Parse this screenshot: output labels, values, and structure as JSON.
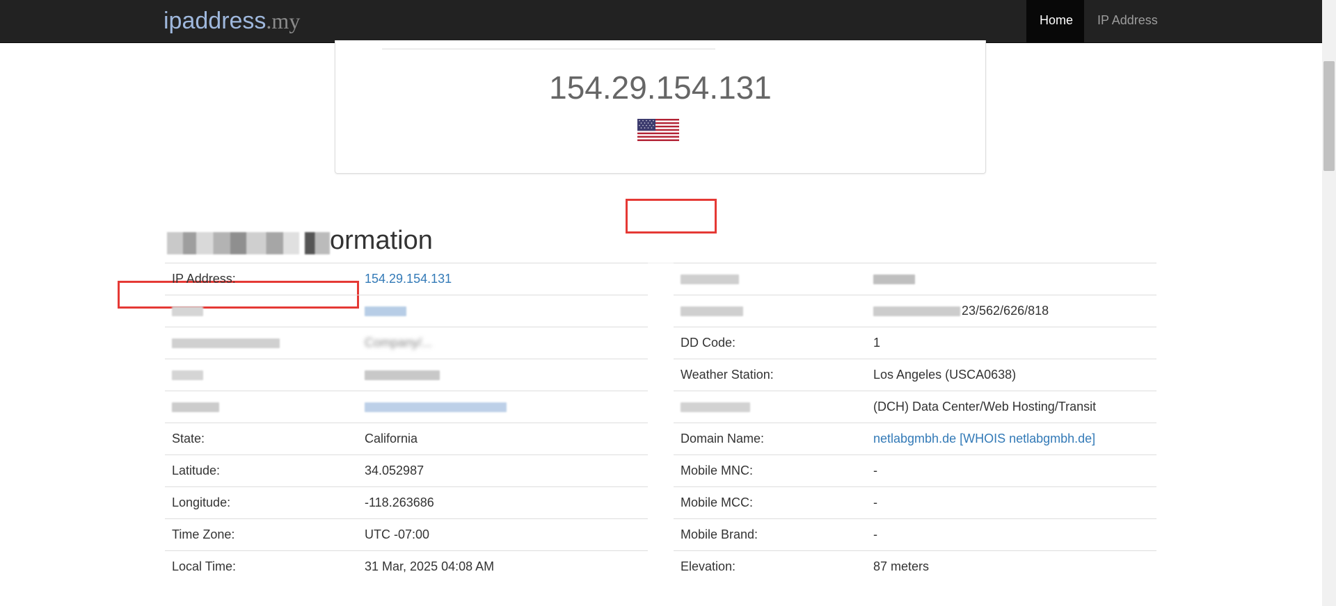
{
  "navbar": {
    "brand_main": "ipaddress",
    "brand_tld": ".my",
    "nav_home": "Home",
    "nav_ip_address": "IP Address"
  },
  "ip_panel": {
    "ip_value": "154.29.154.131",
    "flag_icon": "us-flag-icon"
  },
  "heading": {
    "visible_suffix": "ormation"
  },
  "left_table": [
    {
      "label": "IP Address:",
      "value": "154.29.154.131",
      "value_is_link": true
    },
    {
      "label": "",
      "value": "",
      "redacted": true
    },
    {
      "label": "",
      "value": "Company/...",
      "redacted": true
    },
    {
      "label": "",
      "value": "",
      "redacted": true
    },
    {
      "label": "",
      "value": "",
      "redacted": true
    },
    {
      "label": "State:",
      "value": "California"
    },
    {
      "label": "Latitude:",
      "value": "34.052987"
    },
    {
      "label": "Longitude:",
      "value": "-118.263686"
    },
    {
      "label": "Time Zone:",
      "value": "UTC -07:00"
    },
    {
      "label": "Local Time:",
      "value": "31 Mar, 2025 04:08 AM"
    }
  ],
  "right_table": [
    {
      "label": "",
      "value": "",
      "redacted": true
    },
    {
      "label": "",
      "value": "23/562/626/818",
      "redacted": true
    },
    {
      "label": "DD Code:",
      "value": "1"
    },
    {
      "label": "Weather Station:",
      "value": "Los Angeles (USCA0638)"
    },
    {
      "label": "",
      "value": "(DCH) Data Center/Web Hosting/Transit",
      "redacted": true
    },
    {
      "label": "Domain Name:",
      "value": "netlabgmbh.de [WHOIS netlabgmbh.de]",
      "value_is_link": true
    },
    {
      "label": "Mobile MNC:",
      "value": "-"
    },
    {
      "label": "Mobile MCC:",
      "value": "-"
    },
    {
      "label": "Mobile Brand:",
      "value": "-"
    },
    {
      "label": "Elevation:",
      "value": "87 meters"
    }
  ],
  "colors": {
    "navbar_bg": "#222222",
    "link": "#337ab7",
    "annotation_red": "#e53935"
  }
}
